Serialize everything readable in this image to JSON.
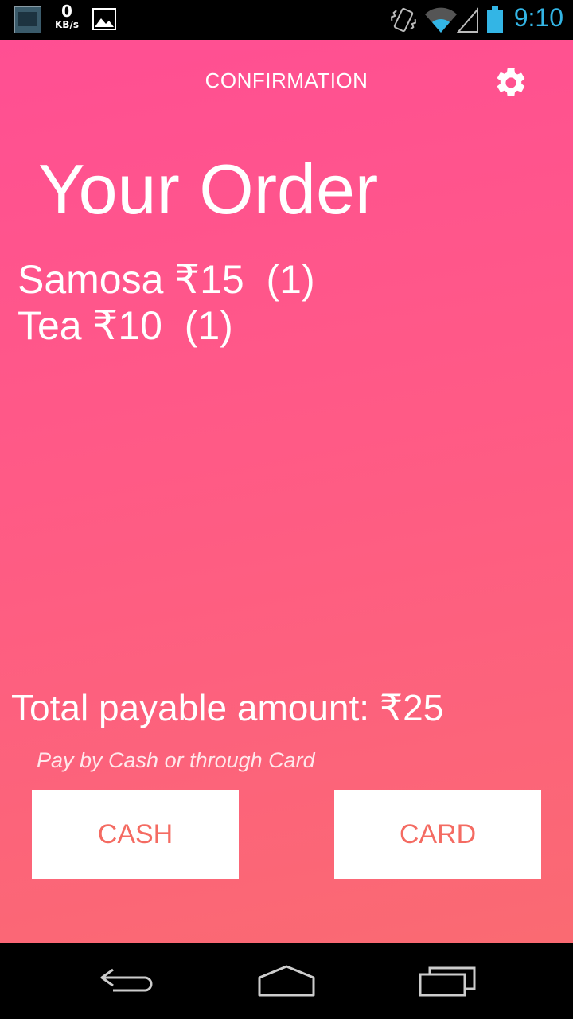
{
  "status_bar": {
    "net_speed": "0",
    "net_unit": "KB/s",
    "time": "9:10",
    "icons": [
      "screenshot-thumbnail-icon",
      "image-icon",
      "vibrate-icon",
      "wifi-icon",
      "signal-icon",
      "battery-icon"
    ],
    "time_color": "#33b5e5"
  },
  "header": {
    "title": "CONFIRMATION",
    "settings_icon": "gear-icon"
  },
  "main": {
    "title": "Your Order",
    "order_items": [
      {
        "text": "Samosa ₹15  (1)"
      },
      {
        "text": "Tea ₹10  (1)"
      }
    ],
    "total": "Total payable amount: ₹25",
    "payment_hint": "Pay by Cash or through Card",
    "buttons": {
      "cash": "CASH",
      "card": "CARD"
    }
  },
  "nav_bar": {
    "icons": [
      "back-icon",
      "home-icon",
      "recents-icon"
    ]
  },
  "colors": {
    "gradient_top": "#ff4f93",
    "gradient_bottom": "#fa6a72",
    "button_text": "#f46b62"
  }
}
